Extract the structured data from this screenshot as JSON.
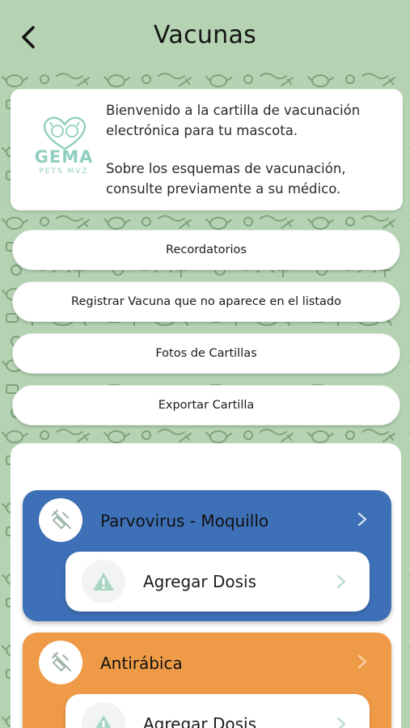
{
  "header": {
    "title": "Vacunas",
    "back_icon": "chevron-left-icon"
  },
  "welcome": {
    "logo_name": "GEMA",
    "logo_sub": "PETS MVZ",
    "line1": "Bienvenido a la cartilla de vacunación electrónica para tu mascota.",
    "line2": "Sobre los esquemas de vacunación, consulte previamente a su médico."
  },
  "actions": [
    {
      "label": "Recordatorios"
    },
    {
      "label": "Registrar Vacuna que no aparece en el listado"
    },
    {
      "label": "Fotos de Cartillas"
    },
    {
      "label": "Exportar Cartilla"
    }
  ],
  "vaccines": [
    {
      "name": "Parvovirus - Moquillo",
      "color": "#3d70b6",
      "dose_label": "Agregar Dosis"
    },
    {
      "name": "Antirábica",
      "color": "#ef9a46",
      "dose_label": "Agregar Dosis"
    }
  ],
  "colors": {
    "background": "#b5d3b3",
    "pattern": "#7fa27d",
    "logo": "#8fcfbf",
    "warning": "#a9d6c3"
  }
}
